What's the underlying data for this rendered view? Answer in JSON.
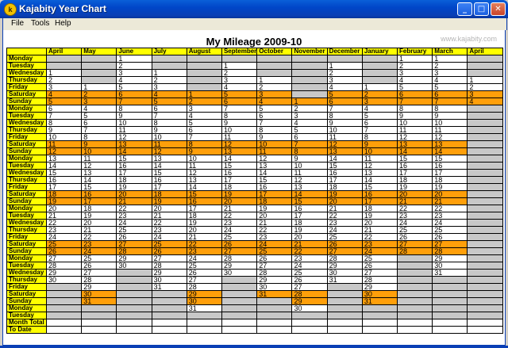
{
  "window": {
    "title": "Kajabity Year Chart",
    "icon_name": "app-logo-icon"
  },
  "menu": [
    "File",
    "Tools",
    "Help"
  ],
  "chart": {
    "title": "My Mileage 2009-10",
    "watermark": "www.kajabity.com"
  },
  "columns": [
    "April",
    "May",
    "June",
    "July",
    "August",
    "September",
    "October",
    "November",
    "December",
    "January",
    "February",
    "March",
    "April"
  ],
  "day_names": [
    "Monday",
    "Tuesday",
    "Wednesday",
    "Thursday",
    "Friday",
    "Saturday",
    "Sunday"
  ],
  "start_offset": [
    2,
    4,
    0,
    2,
    5,
    1,
    3,
    6,
    1,
    4,
    0,
    0,
    3
  ],
  "month_days": [
    30,
    31,
    30,
    31,
    31,
    30,
    31,
    30,
    31,
    31,
    28,
    31,
    4
  ],
  "footer_rows": [
    "Month Total",
    "To Date"
  ],
  "colors": {
    "header": "#ffff00",
    "weekend": "#ff9f0a",
    "inactive": "#c8c8c8",
    "titlebar": "#0a5fd8"
  }
}
